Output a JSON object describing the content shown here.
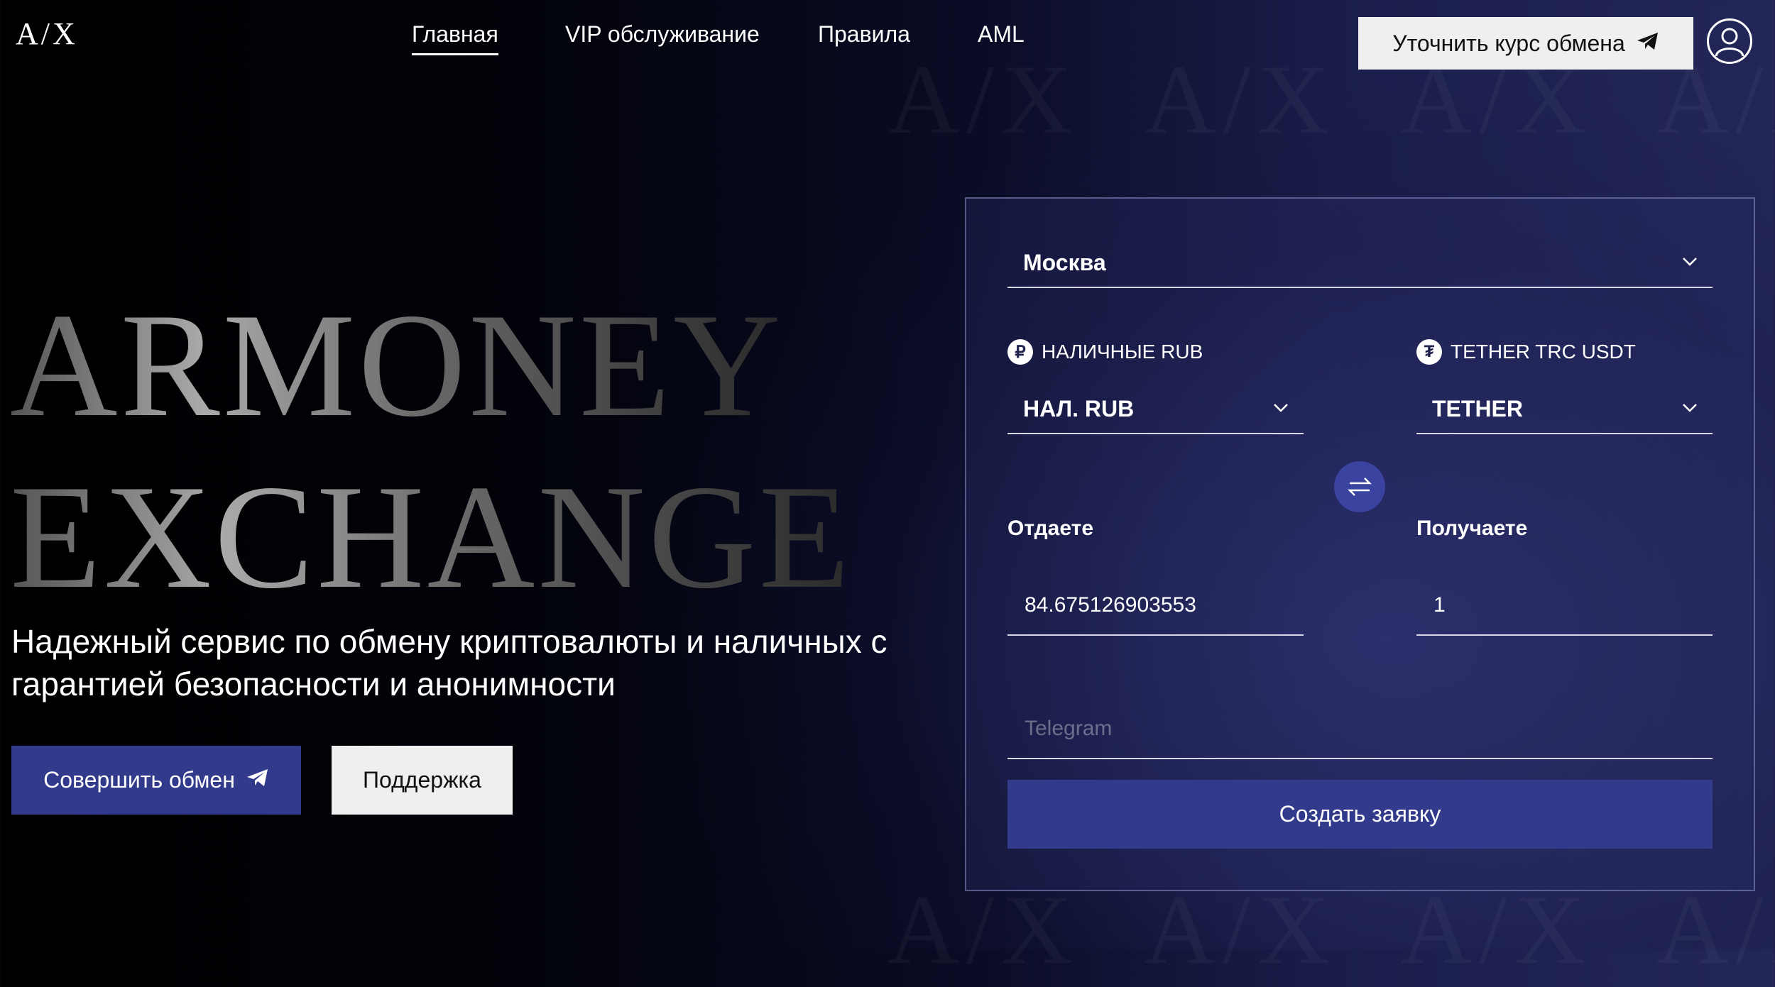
{
  "header": {
    "logo": "A/X",
    "nav": [
      {
        "label": "Главная",
        "active": true
      },
      {
        "label": "VIP обслуживание",
        "active": false
      },
      {
        "label": "Правила",
        "active": false
      },
      {
        "label": "AML",
        "active": false
      }
    ],
    "rate_button_label": "Уточнить курс обмена",
    "rate_button_icon": "telegram-icon",
    "profile_icon": "user-icon"
  },
  "hero": {
    "title_line1": "ARMONEY",
    "title_line2": "EXCHANGE",
    "subtitle": "Надежный сервис по обмену криптовалюты и наличных с гарантией безопасности и анонимности",
    "exchange_button": "Совершить обмен",
    "support_button": "Поддержка"
  },
  "form": {
    "city": "Москва",
    "give_currency": {
      "label": "НАЛИЧНЫЕ RUB",
      "selected": "НАЛ. RUB",
      "icon": "ruble-icon",
      "icon_glyph": "₽"
    },
    "get_currency": {
      "label": "TETHER TRC USDT",
      "selected": "TETHER",
      "icon": "tether-icon",
      "icon_glyph": "₮"
    },
    "give_label": "Отдаете",
    "give_value": "84.675126903553",
    "get_label": "Получаете",
    "get_value": "1",
    "telegram_placeholder": "Telegram",
    "submit_label": "Создать заявку"
  },
  "colors": {
    "accent": "#323a8c",
    "button_light": "#efefef",
    "background_dark": "#000000"
  }
}
